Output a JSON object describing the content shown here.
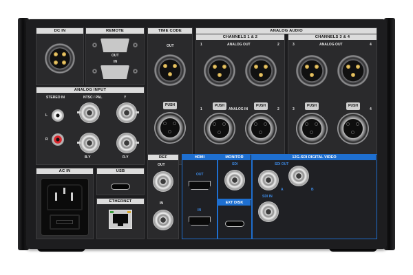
{
  "panel": {
    "dc_in": "DC IN",
    "remote": "REMOTE",
    "remote_out": "OUT",
    "remote_in": "IN",
    "time_code": "TIME CODE",
    "time_code_out": "OUT",
    "analog_audio": "ANALOG AUDIO",
    "channels_12": "CHANNELS 1 & 2",
    "channels_34": "CHANNELS 3 & 4",
    "analog_out": "ANALOG OUT",
    "analog_in": "ANALOG IN",
    "ch1": "1",
    "ch2": "2",
    "ch3": "3",
    "ch4": "4",
    "push": "PUSH",
    "analog_input": "ANALOG INPUT",
    "stereo_in": "STEREO IN",
    "ntsc_pal": "NTSC / PAL",
    "y": "Y",
    "b_y": "B-Y",
    "r_y": "R-Y",
    "l": "L",
    "r": "R",
    "ref": "REF",
    "ref_out": "OUT",
    "ref_in": "IN",
    "hdmi": "HDMI",
    "hdmi_out": "OUT",
    "hdmi_in": "IN",
    "monitor": "MONITOR",
    "monitor_sdi": "SDI",
    "ext_disk": "EXT DISK",
    "sdi_video": "12G-SDI DIGITAL VIDEO",
    "sdi_out": "SDI OUT",
    "sdi_a": "A",
    "sdi_b": "B",
    "sdi_in": "SDI IN",
    "ac_in": "AC IN",
    "usb": "USB",
    "ethernet": "ETHERNET"
  },
  "colors": {
    "accent_blue": "#1e6fd0",
    "chassis": "#1d1d1f",
    "label_bg": "#dcdcdc"
  }
}
